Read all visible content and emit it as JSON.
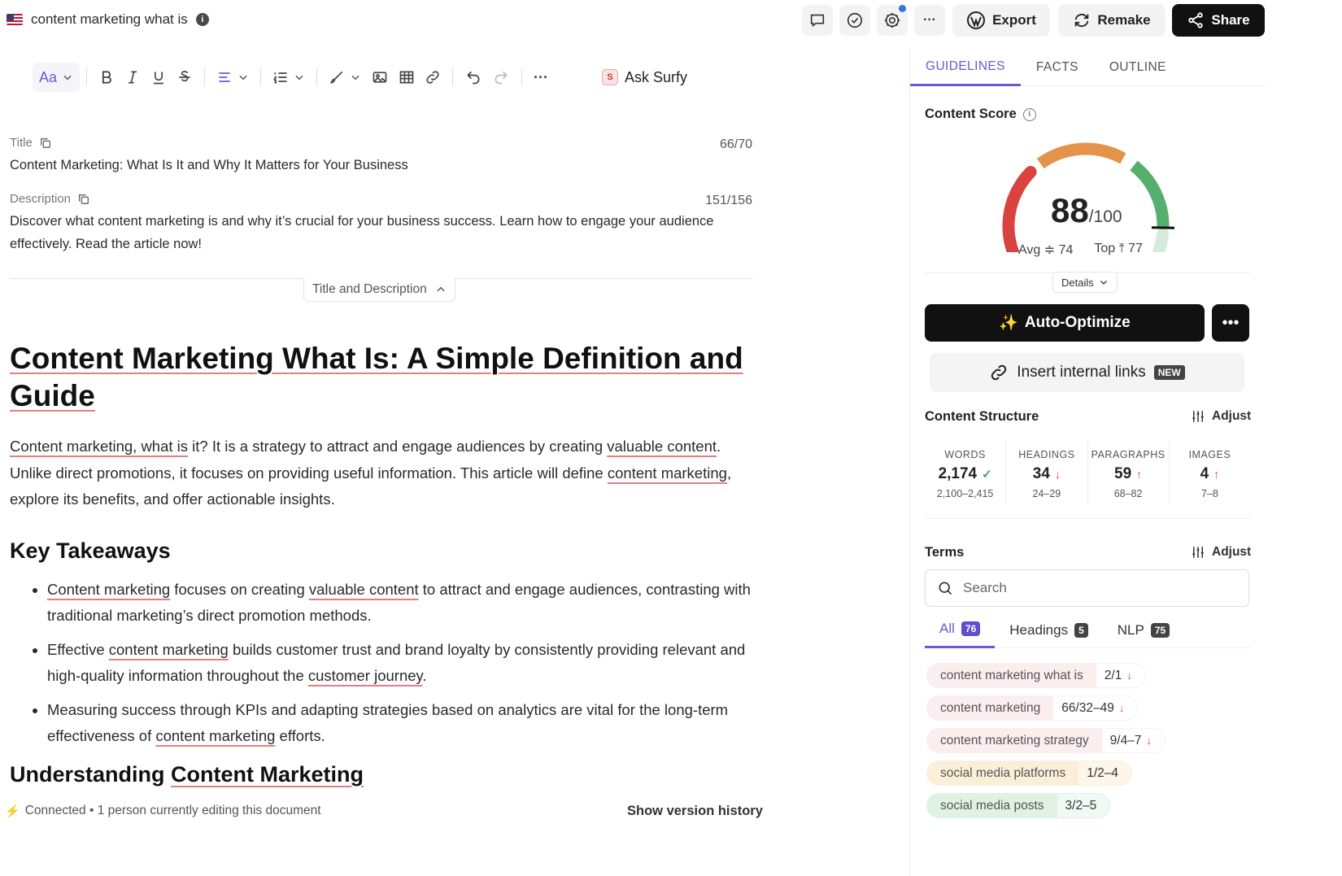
{
  "header": {
    "doc_title": "content marketing what is",
    "info": "i",
    "export_label": "Export",
    "remake_label": "Remake",
    "share_label": "Share",
    "more": "···"
  },
  "toolbar": {
    "font_label": "Aa",
    "ask_surfy_label": "Ask Surfy",
    "surfy_logo": "S",
    "more": "···"
  },
  "meta": {
    "title_label": "Title",
    "title_count": "66/70",
    "title_text": "Content Marketing: What Is It and Why It Matters for Your Business",
    "description_label": "Description",
    "description_count": "151/156",
    "description_text": "Discover what content marketing is and why it’s crucial for your business success. Learn how to engage your audience effectively. Read the article now!",
    "toggle_label": "Title and Description"
  },
  "article": {
    "h1": "Content Marketing What Is: A Simple Definition and Guide",
    "intro": {
      "p1": "Content marketing, what is",
      "p2": " it? It is a strategy to attract and engage audiences by creating ",
      "p3": "valuable content",
      "p4": ". Unlike direct promotions, it focuses on providing useful information. This article will define ",
      "p5": "content marketing",
      "p6": ", explore its benefits, and offer actionable insights."
    },
    "h2_takeaways": "Key Takeaways",
    "takeaways": [
      {
        "a": "Content marketing",
        "b": " focuses on creating ",
        "c": "valuable content",
        "d": " to attract and engage audiences, contrasting with traditional marketing’s direct promotion methods."
      },
      {
        "a": "Effective ",
        "b": "content marketing",
        "c": " builds customer trust and brand loyalty by consistently providing relevant and high-quality information throughout the ",
        "d": "customer journey",
        "e": "."
      },
      {
        "a": "Measuring success through KPIs and adapting strategies based on analytics are vital for the long-term effectiveness of ",
        "b": "content marketing",
        "c": " efforts."
      }
    ],
    "h2_understanding_a": "Understanding ",
    "h2_understanding_b": "Content Marketing"
  },
  "footer": {
    "status": "Connected • 1 person currently editing this document",
    "version_history": "Show version history"
  },
  "panel": {
    "tabs": [
      "GUIDELINES",
      "FACTS",
      "OUTLINE"
    ],
    "active_tab": "GUIDELINES",
    "content_score_label": "Content Score",
    "score": 88,
    "score_display": "88",
    "score_max": "/100",
    "avg_label": "Avg",
    "avg_value": "74",
    "top_label": "Top",
    "top_value": "77",
    "details_label": "Details",
    "auto_optimize_label": "Auto-Optimize",
    "insert_links_label": "Insert internal links",
    "new_badge": "NEW",
    "content_structure_label": "Content Structure",
    "adjust_label": "Adjust",
    "stats": [
      {
        "label": "WORDS",
        "value": "2,174",
        "indicator": "✓",
        "range": "2,100–2,415"
      },
      {
        "label": "HEADINGS",
        "value": "34",
        "indicator": "↓",
        "range": "24–29"
      },
      {
        "label": "PARAGRAPHS",
        "value": "59",
        "indicator": "↑",
        "range": "68–82"
      },
      {
        "label": "IMAGES",
        "value": "4",
        "indicator": "↑",
        "range": "7–8"
      }
    ],
    "terms_label": "Terms",
    "search_placeholder": "Search",
    "term_tabs": [
      {
        "label": "All",
        "count": "76"
      },
      {
        "label": "Headings",
        "count": "5"
      },
      {
        "label": "NLP",
        "count": "75"
      }
    ],
    "terms": [
      {
        "name": "content marketing what is",
        "value": "2/1",
        "arrow": "↓"
      },
      {
        "name": "content marketing",
        "value": "66/32–49",
        "arrow": "↓"
      },
      {
        "name": "content marketing strategy",
        "value": "9/4–7",
        "arrow": "↓"
      },
      {
        "name": "social media platforms",
        "value": "1/2–4",
        "arrow": ""
      },
      {
        "name": "social media posts",
        "value": "3/2–5",
        "arrow": ""
      }
    ]
  },
  "colors": {
    "accent": "#6a5acd",
    "term_red": "#fbeeee",
    "term_yellow": "#fbefd9",
    "term_green": "#dff2e4"
  }
}
